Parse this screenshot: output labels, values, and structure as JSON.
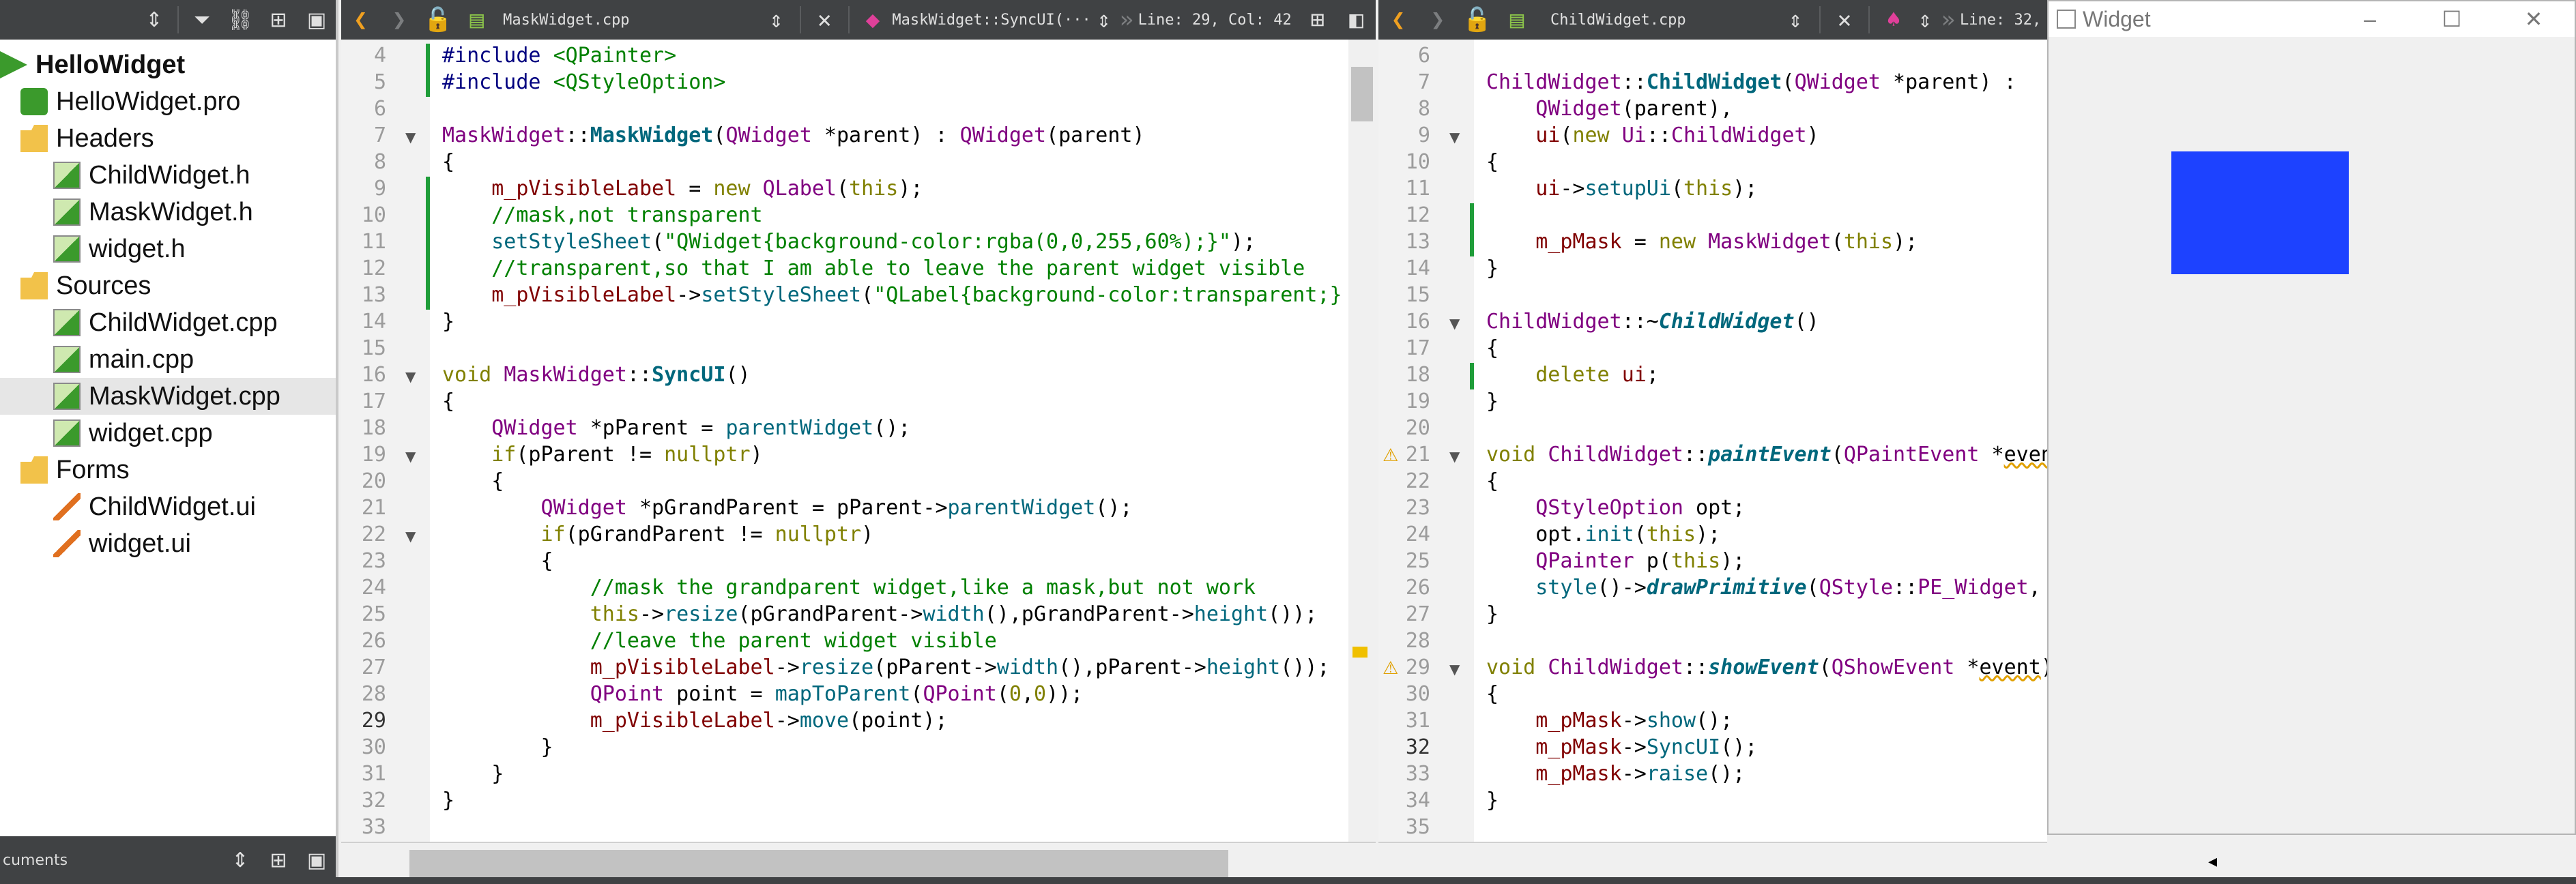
{
  "sidebar": {
    "tree": [
      {
        "label": "HelloWidget",
        "kind": "project",
        "depth": 0,
        "bold": true
      },
      {
        "label": "HelloWidget.pro",
        "kind": "pro-file",
        "depth": 1
      },
      {
        "label": "Headers",
        "kind": "folder",
        "depth": 1
      },
      {
        "label": "ChildWidget.h",
        "kind": "file",
        "depth": 2
      },
      {
        "label": "MaskWidget.h",
        "kind": "file",
        "depth": 2
      },
      {
        "label": "widget.h",
        "kind": "file",
        "depth": 2
      },
      {
        "label": "Sources",
        "kind": "folder",
        "depth": 1
      },
      {
        "label": "ChildWidget.cpp",
        "kind": "file",
        "depth": 2
      },
      {
        "label": "main.cpp",
        "kind": "file",
        "depth": 2
      },
      {
        "label": "MaskWidget.cpp",
        "kind": "file",
        "depth": 2,
        "selected": true
      },
      {
        "label": "widget.cpp",
        "kind": "file",
        "depth": 2
      },
      {
        "label": "Forms",
        "kind": "folder",
        "depth": 1
      },
      {
        "label": "ChildWidget.ui",
        "kind": "ui-file",
        "depth": 2
      },
      {
        "label": "widget.ui",
        "kind": "ui-file",
        "depth": 2
      }
    ],
    "bottom_label": "cuments"
  },
  "editor_left": {
    "file": "MaskWidget.cpp",
    "symbol": "MaskWidget::SyncUI(···",
    "position": "Line: 29, Col: 42",
    "line_start": 4,
    "current_line": 29,
    "changed_lines": [
      4,
      5,
      9,
      10,
      11,
      12,
      13
    ],
    "fold_lines": [
      7,
      16,
      19,
      22
    ],
    "lines": [
      [
        [
          "pp",
          "#include "
        ],
        [
          "st",
          "<QPainter>"
        ]
      ],
      [
        [
          "pp",
          "#include "
        ],
        [
          "st",
          "<QStyleOption>"
        ]
      ],
      [],
      [
        [
          "ty",
          "MaskWidget"
        ],
        [
          "n",
          "::"
        ],
        [
          "fnb",
          "MaskWidget"
        ],
        [
          "n",
          "("
        ],
        [
          "ty",
          "QWidget"
        ],
        [
          "n",
          " *"
        ],
        [
          "n",
          "parent"
        ],
        [
          "n",
          ") : "
        ],
        [
          "ty",
          "QWidget"
        ],
        [
          "n",
          "("
        ],
        [
          "n",
          "parent"
        ],
        [
          "n",
          ")"
        ]
      ],
      [
        [
          "n",
          "{"
        ]
      ],
      [
        [
          "n",
          "    "
        ],
        [
          "mem",
          "m_pVisibleLabel"
        ],
        [
          "n",
          " = "
        ],
        [
          "kw",
          "new"
        ],
        [
          "n",
          " "
        ],
        [
          "ty",
          "QLabel"
        ],
        [
          "n",
          "("
        ],
        [
          "kw",
          "this"
        ],
        [
          "n",
          ");"
        ]
      ],
      [
        [
          "cm",
          "    //mask,not transparent"
        ]
      ],
      [
        [
          "n",
          "    "
        ],
        [
          "fn",
          "setStyleSheet"
        ],
        [
          "n",
          "("
        ],
        [
          "st",
          "\"QWidget{background-color:rgba(0,0,255,60%);}\""
        ],
        [
          "n",
          ");"
        ]
      ],
      [
        [
          "cm",
          "    //transparent,so that I am able to leave the parent widget visible"
        ]
      ],
      [
        [
          "n",
          "    "
        ],
        [
          "mem",
          "m_pVisibleLabel"
        ],
        [
          "n",
          "->"
        ],
        [
          "fn",
          "setStyleSheet"
        ],
        [
          "n",
          "("
        ],
        [
          "st",
          "\"QLabel{background-color:transparent;}"
        ]
      ],
      [
        [
          "n",
          "}"
        ]
      ],
      [],
      [
        [
          "kw",
          "void"
        ],
        [
          "n",
          " "
        ],
        [
          "ty",
          "MaskWidget"
        ],
        [
          "n",
          "::"
        ],
        [
          "fnb",
          "SyncUI"
        ],
        [
          "n",
          "()"
        ]
      ],
      [
        [
          "n",
          "{"
        ]
      ],
      [
        [
          "n",
          "    "
        ],
        [
          "ty",
          "QWidget"
        ],
        [
          "n",
          " *pParent = "
        ],
        [
          "fn",
          "parentWidget"
        ],
        [
          "n",
          "();"
        ]
      ],
      [
        [
          "n",
          "    "
        ],
        [
          "kw",
          "if"
        ],
        [
          "n",
          "(pParent != "
        ],
        [
          "kw",
          "nullptr"
        ],
        [
          "n",
          ")"
        ]
      ],
      [
        [
          "n",
          "    {"
        ]
      ],
      [
        [
          "n",
          "        "
        ],
        [
          "ty",
          "QWidget"
        ],
        [
          "n",
          " *pGrandParent = pParent->"
        ],
        [
          "fn",
          "parentWidget"
        ],
        [
          "n",
          "();"
        ]
      ],
      [
        [
          "n",
          "        "
        ],
        [
          "kw",
          "if"
        ],
        [
          "n",
          "(pGrandParent != "
        ],
        [
          "kw",
          "nullptr"
        ],
        [
          "n",
          ")"
        ]
      ],
      [
        [
          "n",
          "        {"
        ]
      ],
      [
        [
          "cm",
          "            //mask the grandparent widget,like a mask,but not work"
        ]
      ],
      [
        [
          "n",
          "            "
        ],
        [
          "kw",
          "this"
        ],
        [
          "n",
          "->"
        ],
        [
          "fn",
          "resize"
        ],
        [
          "n",
          "(pGrandParent->"
        ],
        [
          "fn",
          "width"
        ],
        [
          "n",
          "(),pGrandParent->"
        ],
        [
          "fn",
          "height"
        ],
        [
          "n",
          "());"
        ]
      ],
      [
        [
          "cm",
          "            //leave the parent widget visible"
        ]
      ],
      [
        [
          "n",
          "            "
        ],
        [
          "mem",
          "m_pVisibleLabel"
        ],
        [
          "n",
          "->"
        ],
        [
          "fn",
          "resize"
        ],
        [
          "n",
          "(pParent->"
        ],
        [
          "fn",
          "width"
        ],
        [
          "n",
          "(),pParent->"
        ],
        [
          "fn",
          "height"
        ],
        [
          "n",
          "());"
        ]
      ],
      [
        [
          "n",
          "            "
        ],
        [
          "ty",
          "QPoint"
        ],
        [
          "n",
          " point = "
        ],
        [
          "fn",
          "mapToParent"
        ],
        [
          "n",
          "("
        ],
        [
          "ty",
          "QPoint"
        ],
        [
          "n",
          "("
        ],
        [
          "kw",
          "0"
        ],
        [
          "n",
          ","
        ],
        [
          "kw",
          "0"
        ],
        [
          "n",
          "));"
        ]
      ],
      [
        [
          "n",
          "            "
        ],
        [
          "mem",
          "m_pVisibleLabel"
        ],
        [
          "n",
          "->"
        ],
        [
          "fn",
          "move"
        ],
        [
          "n",
          "(point);"
        ]
      ],
      [
        [
          "n",
          "        }"
        ]
      ],
      [
        [
          "n",
          "    }"
        ]
      ],
      [
        [
          "n",
          "}"
        ]
      ],
      []
    ]
  },
  "editor_right": {
    "file": "ChildWidget.cpp",
    "position": "Line: 32,",
    "line_start": 6,
    "current_line": 32,
    "changed_lines": [
      12,
      13,
      18
    ],
    "fold_lines": [
      9,
      16,
      21,
      29
    ],
    "warn_lines": [
      21,
      29
    ],
    "lines": [
      [],
      [
        [
          "ty",
          "ChildWidget"
        ],
        [
          "n",
          "::"
        ],
        [
          "fnb",
          "ChildWidget"
        ],
        [
          "n",
          "("
        ],
        [
          "ty",
          "QWidget"
        ],
        [
          "n",
          " *parent) :"
        ]
      ],
      [
        [
          "n",
          "    "
        ],
        [
          "ty",
          "QWidget"
        ],
        [
          "n",
          "(parent),"
        ]
      ],
      [
        [
          "n",
          "    "
        ],
        [
          "mem",
          "ui"
        ],
        [
          "n",
          "("
        ],
        [
          "kw",
          "new"
        ],
        [
          "n",
          " "
        ],
        [
          "ty",
          "Ui"
        ],
        [
          "n",
          "::"
        ],
        [
          "ty",
          "ChildWidget"
        ],
        [
          "n",
          ")"
        ]
      ],
      [
        [
          "n",
          "{"
        ]
      ],
      [
        [
          "n",
          "    "
        ],
        [
          "mem",
          "ui"
        ],
        [
          "n",
          "->"
        ],
        [
          "fn",
          "setupUi"
        ],
        [
          "n",
          "("
        ],
        [
          "kw",
          "this"
        ],
        [
          "n",
          ");"
        ]
      ],
      [],
      [
        [
          "n",
          "    "
        ],
        [
          "mem",
          "m_pMask"
        ],
        [
          "n",
          " = "
        ],
        [
          "kw",
          "new"
        ],
        [
          "n",
          " "
        ],
        [
          "ty",
          "MaskWidget"
        ],
        [
          "n",
          "("
        ],
        [
          "kw",
          "this"
        ],
        [
          "n",
          ");"
        ]
      ],
      [
        [
          "n",
          "}"
        ]
      ],
      [],
      [
        [
          "ty",
          "ChildWidget"
        ],
        [
          "n",
          "::~"
        ],
        [
          "fni",
          "ChildWidget"
        ],
        [
          "n",
          "()"
        ]
      ],
      [
        [
          "n",
          "{"
        ]
      ],
      [
        [
          "n",
          "    "
        ],
        [
          "kw",
          "delete"
        ],
        [
          "n",
          " "
        ],
        [
          "mem",
          "ui"
        ],
        [
          "n",
          ";"
        ]
      ],
      [
        [
          "n",
          "}"
        ]
      ],
      [],
      [
        [
          "kw",
          "void"
        ],
        [
          "n",
          " "
        ],
        [
          "ty",
          "ChildWidget"
        ],
        [
          "n",
          "::"
        ],
        [
          "fni",
          "paintEvent"
        ],
        [
          "n",
          "("
        ],
        [
          "ty",
          "QPaintEvent"
        ],
        [
          "n",
          " *"
        ],
        [
          "w",
          "even"
        ]
      ],
      [
        [
          "n",
          "{"
        ]
      ],
      [
        [
          "n",
          "    "
        ],
        [
          "ty",
          "QStyleOption"
        ],
        [
          "n",
          " opt;"
        ]
      ],
      [
        [
          "n",
          "    opt."
        ],
        [
          "fn",
          "init"
        ],
        [
          "n",
          "("
        ],
        [
          "kw",
          "this"
        ],
        [
          "n",
          ");"
        ]
      ],
      [
        [
          "n",
          "    "
        ],
        [
          "ty",
          "QPainter"
        ],
        [
          "n",
          " p("
        ],
        [
          "kw",
          "this"
        ],
        [
          "n",
          ");"
        ]
      ],
      [
        [
          "n",
          "    "
        ],
        [
          "fn",
          "style"
        ],
        [
          "n",
          "()->"
        ],
        [
          "fni",
          "drawPrimitive"
        ],
        [
          "n",
          "("
        ],
        [
          "ty",
          "QStyle"
        ],
        [
          "n",
          "::"
        ],
        [
          "ty",
          "PE_Widget"
        ],
        [
          "n",
          ","
        ]
      ],
      [
        [
          "n",
          "}"
        ]
      ],
      [],
      [
        [
          "kw",
          "void"
        ],
        [
          "n",
          " "
        ],
        [
          "ty",
          "ChildWidget"
        ],
        [
          "n",
          "::"
        ],
        [
          "fni",
          "showEvent"
        ],
        [
          "n",
          "("
        ],
        [
          "ty",
          "QShowEvent"
        ],
        [
          "n",
          " *"
        ],
        [
          "w",
          "event"
        ],
        [
          "n",
          ")"
        ]
      ],
      [
        [
          "n",
          "{"
        ]
      ],
      [
        [
          "n",
          "    "
        ],
        [
          "mem",
          "m_pMask"
        ],
        [
          "n",
          "->"
        ],
        [
          "fn",
          "show"
        ],
        [
          "n",
          "();"
        ]
      ],
      [
        [
          "n",
          "    "
        ],
        [
          "mem",
          "m_pMask"
        ],
        [
          "n",
          "->"
        ],
        [
          "fn",
          "SyncUI"
        ],
        [
          "n",
          "();"
        ]
      ],
      [
        [
          "n",
          "    "
        ],
        [
          "mem",
          "m_pMask"
        ],
        [
          "n",
          "->"
        ],
        [
          "fn",
          "raise"
        ],
        [
          "n",
          "();"
        ]
      ],
      [
        [
          "n",
          "}"
        ]
      ],
      []
    ]
  },
  "widget_window": {
    "title": "Widget",
    "box_color": "#1d42ff"
  }
}
